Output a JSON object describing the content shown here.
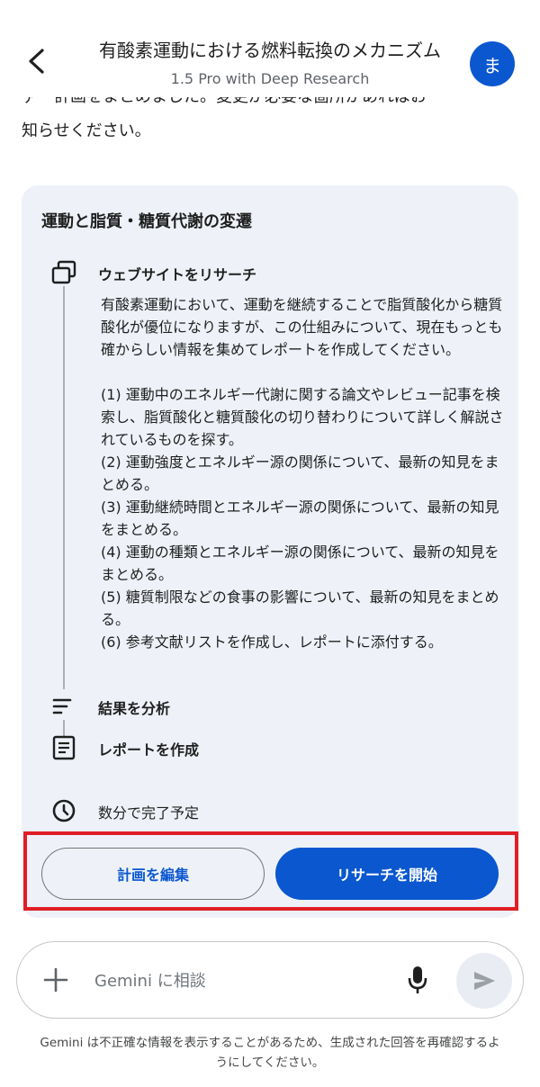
{
  "header": {
    "title": "有酸素運動における燃料転換のメカニズム",
    "subtitle": "1.5 Pro with Deep Research",
    "avatar_letter": "ま",
    "back_icon": "chevron-left-icon"
  },
  "intro": {
    "cut_line": "ァー計画をまとめました。変更が必要な箇所があればお",
    "line": "知らせください。"
  },
  "plan": {
    "title": "運動と脂質・糖質代謝の変遷",
    "steps": [
      {
        "label": "ウェブサイトをリサーチ",
        "icon": "web-pages-icon",
        "body": [
          "有酸素運動において、運動を継続することで脂質酸化から糖質酸化が優位になりますが、この仕組みについて、現在もっとも確からしい情報を集めてレポートを作成してください。",
          "",
          "(1) 運動中のエネルギー代謝に関する論文やレビュー記事を検索し、脂質酸化と糖質酸化の切り替わりについて詳しく解説されているものを探す。",
          "(2) 運動強度とエネルギー源の関係について、最新の知見をまとめる。",
          "(3) 運動継続時間とエネルギー源の関係について、最新の知見をまとめる。",
          "(4) 運動の種類とエネルギー源の関係について、最新の知見をまとめる。",
          "(5) 糖質制限などの食事の影響について、最新の知見をまとめる。",
          "(6) 参考文献リストを作成し、レポートに添付する。"
        ]
      },
      {
        "label": "結果を分析",
        "icon": "analyze-lines-icon"
      },
      {
        "label": "レポートを作成",
        "icon": "report-document-icon"
      }
    ],
    "eta": "数分で完了予定",
    "eta_icon": "clock-icon"
  },
  "buttons": {
    "edit": "計画を編集",
    "start": "リサーチを開始"
  },
  "input": {
    "placeholder": "Gemini に相談",
    "plus_icon": "plus-icon",
    "mic_icon": "microphone-icon",
    "send_icon": "send-icon"
  },
  "disclaimer": "Gemini は不正確な情報を表示することがあるため、生成された回答を再確認するようにしてください。",
  "colors": {
    "accent": "#0b57d0",
    "card_bg": "#eef2f8",
    "highlight": "#e01e26"
  }
}
